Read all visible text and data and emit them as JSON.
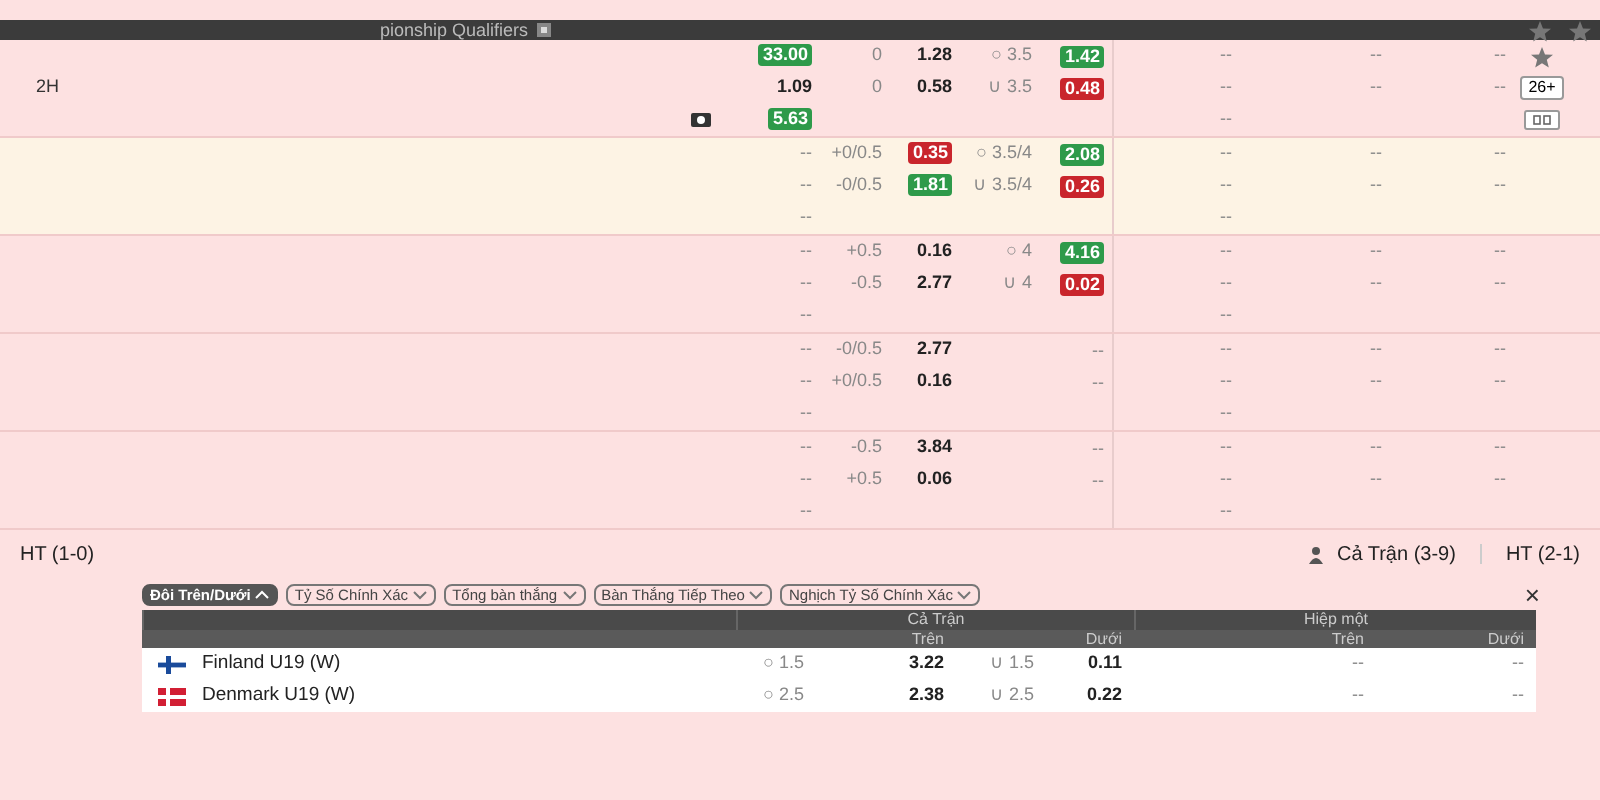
{
  "header": {
    "title": "pionship Qualifiers"
  },
  "sections": [
    {
      "highlighted": false,
      "label": "2H",
      "has_tv": true,
      "actions": [
        {
          "kind": "star"
        },
        {
          "kind": "button",
          "label": "26+"
        },
        {
          "kind": "stats"
        }
      ],
      "rows": [
        {
          "c1": {
            "text": "33.00",
            "up": true,
            "down": false
          },
          "hdp": "0",
          "hdp_odds": {
            "text": "1.28",
            "up": false,
            "down": false
          },
          "ou": "○ 3.5",
          "ou_odds": {
            "text": "1.42",
            "up": true,
            "down": false
          },
          "ht": [
            "--",
            "--",
            "--"
          ]
        },
        {
          "c1": {
            "text": "1.09",
            "up": false,
            "down": false
          },
          "hdp": "0",
          "hdp_odds": {
            "text": "0.58",
            "up": false,
            "down": false
          },
          "ou": "∪ 3.5",
          "ou_odds": {
            "text": "0.48",
            "up": false,
            "down": true
          },
          "ht": [
            "--",
            "--",
            "--"
          ]
        },
        {
          "c1": {
            "text": "5.63",
            "up": true,
            "down": false
          },
          "ht": [
            "--"
          ]
        }
      ]
    },
    {
      "highlighted": true,
      "has_tv": false,
      "rows": [
        {
          "c1": {
            "text": "--",
            "up": false,
            "down": false
          },
          "hdp": "+0/0.5",
          "hdp_odds": {
            "text": "0.35",
            "up": false,
            "down": true
          },
          "ou": "○ 3.5/4",
          "ou_odds": {
            "text": "2.08",
            "up": true,
            "down": false
          },
          "ht": [
            "--",
            "--",
            "--"
          ]
        },
        {
          "c1": {
            "text": "--",
            "up": false,
            "down": false
          },
          "hdp": "-0/0.5",
          "hdp_odds": {
            "text": "1.81",
            "up": true,
            "down": false
          },
          "ou": "∪ 3.5/4",
          "ou_odds": {
            "text": "0.26",
            "up": false,
            "down": true
          },
          "ht": [
            "--",
            "--",
            "--"
          ]
        },
        {
          "c1": {
            "text": "--",
            "up": false,
            "down": false
          },
          "ht": [
            "--"
          ]
        }
      ]
    },
    {
      "highlighted": false,
      "has_tv": false,
      "rows": [
        {
          "c1": {
            "text": "--",
            "up": false,
            "down": false
          },
          "hdp": "+0.5",
          "hdp_odds": {
            "text": "0.16",
            "up": false,
            "down": false
          },
          "ou": "○ 4",
          "ou_odds": {
            "text": "4.16",
            "up": true,
            "down": false
          },
          "ht": [
            "--",
            "--",
            "--"
          ]
        },
        {
          "c1": {
            "text": "--",
            "up": false,
            "down": false
          },
          "hdp": "-0.5",
          "hdp_odds": {
            "text": "2.77",
            "up": false,
            "down": false
          },
          "ou": "∪ 4",
          "ou_odds": {
            "text": "0.02",
            "up": false,
            "down": true
          },
          "ht": [
            "--",
            "--",
            "--"
          ]
        },
        {
          "c1": {
            "text": "--",
            "up": false,
            "down": false
          },
          "ht": [
            "--"
          ]
        }
      ]
    },
    {
      "highlighted": false,
      "has_tv": false,
      "rows": [
        {
          "c1": {
            "text": "--",
            "up": false,
            "down": false
          },
          "hdp": "-0/0.5",
          "hdp_odds": {
            "text": "2.77",
            "up": false,
            "down": false
          },
          "ou_odds": {
            "text": "--",
            "up": false,
            "down": false
          },
          "ht": [
            "--",
            "--",
            "--"
          ]
        },
        {
          "c1": {
            "text": "--",
            "up": false,
            "down": false
          },
          "hdp": "+0/0.5",
          "hdp_odds": {
            "text": "0.16",
            "up": false,
            "down": false
          },
          "ou_odds": {
            "text": "--",
            "up": false,
            "down": false
          },
          "ht": [
            "--",
            "--",
            "--"
          ]
        },
        {
          "c1": {
            "text": "--",
            "up": false,
            "down": false
          },
          "ht": [
            "--"
          ]
        }
      ]
    },
    {
      "highlighted": false,
      "has_tv": false,
      "rows": [
        {
          "c1": {
            "text": "--",
            "up": false,
            "down": false
          },
          "hdp": "-0.5",
          "hdp_odds": {
            "text": "3.84",
            "up": false,
            "down": false
          },
          "ou_odds": {
            "text": "--",
            "up": false,
            "down": false
          },
          "ht": [
            "--",
            "--",
            "--"
          ]
        },
        {
          "c1": {
            "text": "--",
            "up": false,
            "down": false
          },
          "hdp": "+0.5",
          "hdp_odds": {
            "text": "0.06",
            "up": false,
            "down": false
          },
          "ou_odds": {
            "text": "--",
            "up": false,
            "down": false
          },
          "ht": [
            "--",
            "--",
            "--"
          ]
        },
        {
          "c1": {
            "text": "--",
            "up": false,
            "down": false
          },
          "ht": [
            "--"
          ]
        }
      ]
    }
  ],
  "footer": {
    "close_label": "×",
    "score_left": "HT (1-0)",
    "score_full": "Cả Trận (3-9)",
    "score_ht": "HT (2-1)",
    "filters": [
      {
        "label": "Đôi Trên/Dưới",
        "selected": true
      },
      {
        "label": "Tỷ Số Chính Xác",
        "selected": false
      },
      {
        "label": "Tổng bàn thắng",
        "selected": false
      },
      {
        "label": "Bàn Thắng Tiếp Theo",
        "selected": false
      },
      {
        "label": "Nghịch Tỷ Số Chính Xác",
        "selected": false
      }
    ],
    "table": {
      "groups": [
        "Cả Trận",
        "Hiệp một"
      ],
      "subheads": [
        "Trên",
        "Dưới",
        "Trên",
        "Dưới"
      ],
      "rows": [
        {
          "kind": "fi",
          "team": "Finland U19 (W)",
          "cells": [
            "○ 1.5",
            "3.22",
            "∪ 1.5",
            "0.11",
            "--",
            "--"
          ]
        },
        {
          "kind": "dk",
          "team": "Denmark U19 (W)",
          "cells": [
            "○ 2.5",
            "2.38",
            "∪ 2.5",
            "0.22",
            "--",
            "--"
          ]
        }
      ]
    }
  }
}
